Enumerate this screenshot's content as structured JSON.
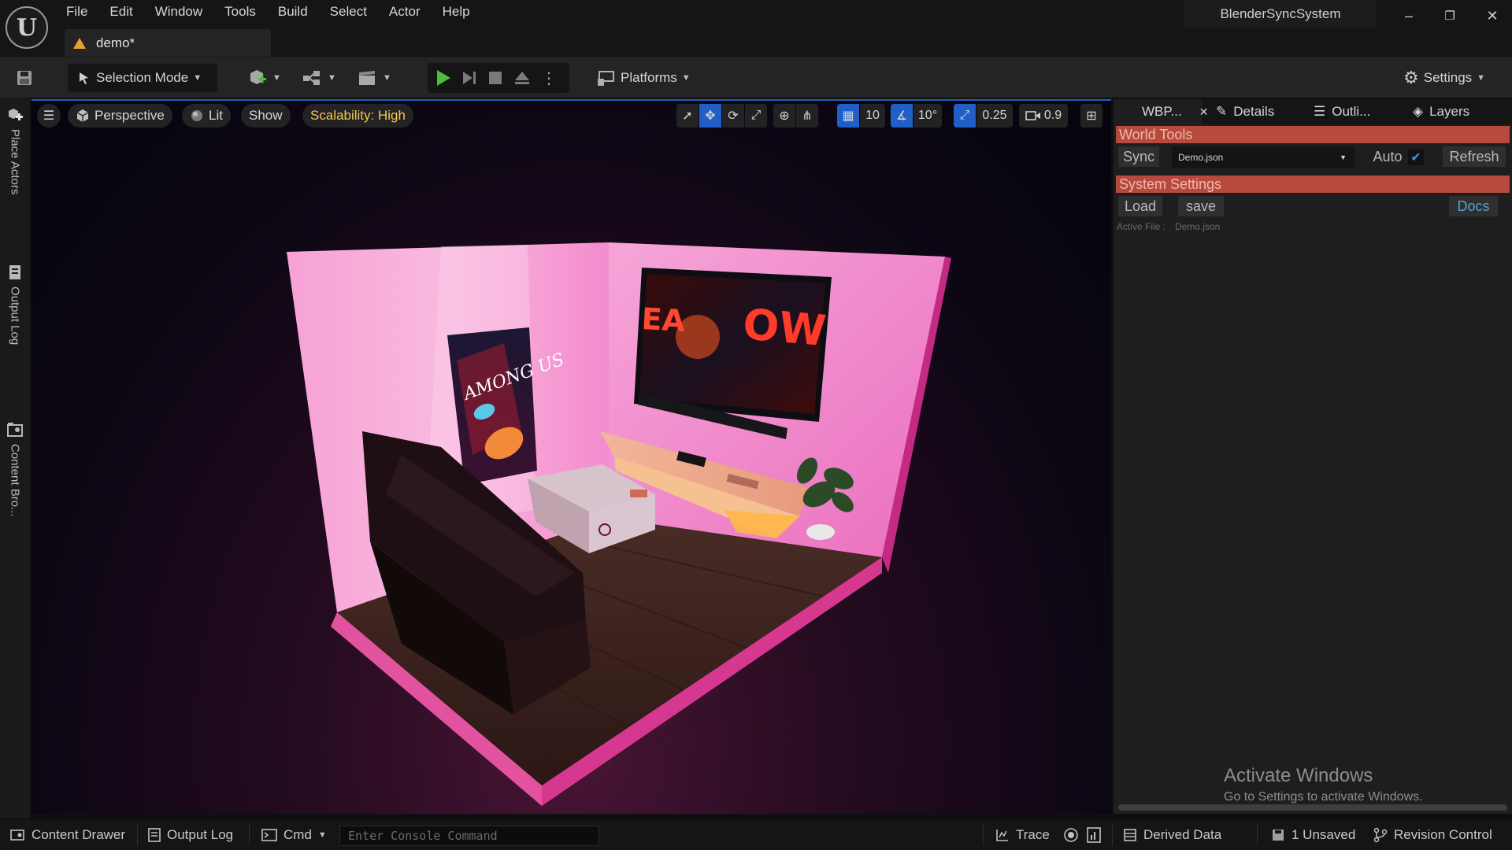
{
  "menu": [
    "File",
    "Edit",
    "Window",
    "Tools",
    "Build",
    "Select",
    "Actor",
    "Help"
  ],
  "document_tab": {
    "label": "demo*"
  },
  "project_name": "BlenderSyncSystem",
  "window_controls": {
    "minimize": "–",
    "restore": "❐",
    "close": "✕"
  },
  "toolbar": {
    "selection_mode": "Selection Mode",
    "platforms": "Platforms",
    "settings": "Settings"
  },
  "left_strip": {
    "place_actors": "Place Actors",
    "output_log": "Output Log",
    "content_browser": "Content Bro..."
  },
  "viewport": {
    "perspective": "Perspective",
    "lit": "Lit",
    "show": "Show",
    "scalability": "Scalability: High",
    "grid_snap": "10",
    "rotation_snap": "10°",
    "scale_snap": "0.25",
    "camera_speed": "0.9",
    "poster_text": "AMONG US",
    "tv_text_left": "EA",
    "tv_text_right": "OW"
  },
  "right_panel": {
    "tabs": {
      "wbp": "WBP...",
      "details": "Details",
      "outliner": "Outli...",
      "layers": "Layers"
    },
    "world_tools": {
      "header": "World Tools",
      "sync": "Sync",
      "file_select": "Demo.json",
      "auto": "Auto",
      "auto_checked": true,
      "refresh": "Refresh"
    },
    "system_settings": {
      "header": "System Settings",
      "load": "Load",
      "save": "save",
      "docs": "Docs",
      "active_file_label": "Active File :",
      "active_file_value": "Demo.json"
    },
    "watermark": {
      "title": "Activate Windows",
      "subtitle": "Go to Settings to activate Windows."
    }
  },
  "statusbar": {
    "content_drawer": "Content Drawer",
    "output_log": "Output Log",
    "cmd": "Cmd",
    "console_placeholder": "Enter Console Command",
    "trace": "Trace",
    "derived_data": "Derived Data",
    "unsaved": "1 Unsaved",
    "revision_control": "Revision Control"
  },
  "colors": {
    "accent_blue": "#1f5fc7",
    "section_red": "#b84a3d",
    "play_green": "#4cbf3a",
    "scalability_yellow": "#f6c94a",
    "wall_pink": "#f08ccc",
    "floor_wood": "#3d2520"
  }
}
